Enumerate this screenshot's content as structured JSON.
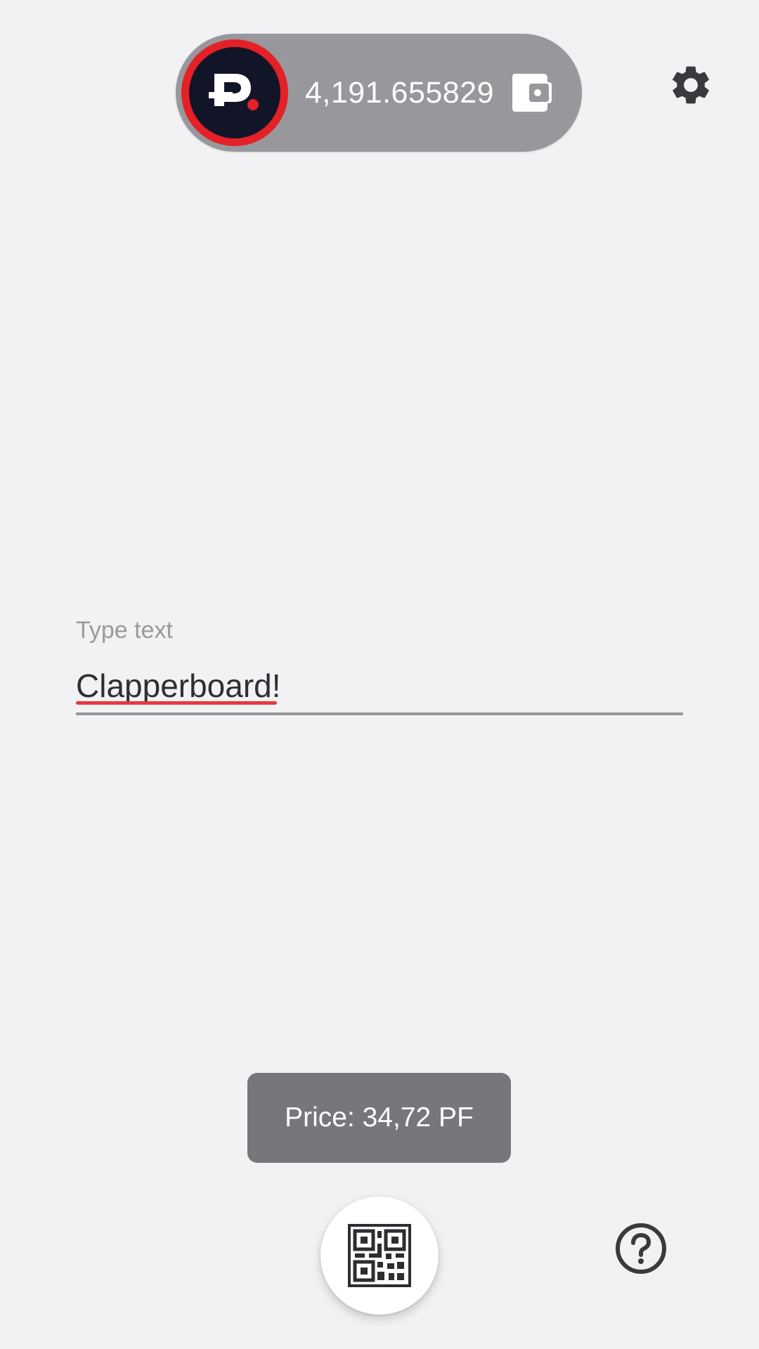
{
  "header": {
    "balance": "4,191.655829",
    "logo_icon": "p-dot-logo-icon",
    "wallet_icon": "wallet-icon",
    "settings_icon": "gear-icon"
  },
  "input": {
    "label": "Type text",
    "value": "Clapperboard!"
  },
  "price_toast": {
    "text": "Price: 34,72 PF"
  },
  "footer": {
    "qr_icon": "qr-code-icon",
    "help_icon": "question-mark-icon"
  },
  "colors": {
    "background": "#f2f2f4",
    "pill": "#98989c",
    "logo_ring": "#e32127",
    "logo_bg": "#121528",
    "toast": "#76767b",
    "spell_underline": "#e53a40"
  }
}
